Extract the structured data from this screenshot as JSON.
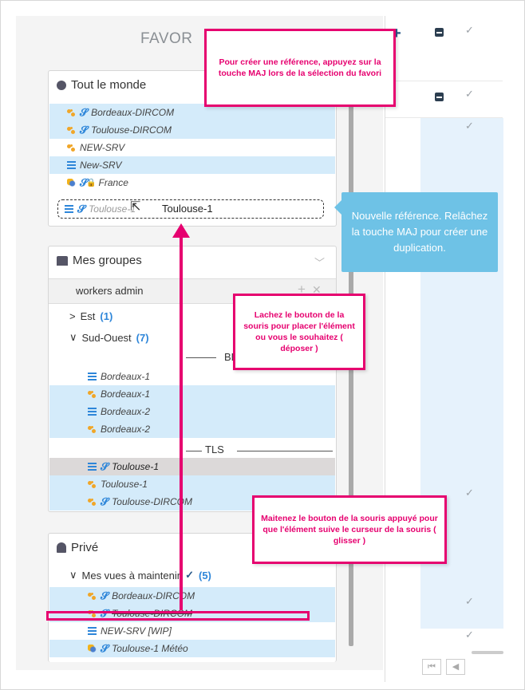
{
  "title": "FAVOR",
  "plus_icon": "+",
  "top_callout": "Pour créer une référence, appuyez sur la touche MAJ lors de la sélection du favori",
  "tooltip": "Nouvelle référence. Relâchez la touche MAJ pour créer une duplication.",
  "drop_callout": "Lachez le bouton de la souris pour placer l'élément ou vous le souhaitez ( déposer )",
  "drag_callout": "Maitenez le bouton de la souris appuyé pour que l'élément suive le curseur de la souris ( glisser )",
  "everyone": {
    "header": "Tout le monde",
    "items": [
      {
        "label": "Bordeaux-DIRCOM",
        "icon": "workflow-icon",
        "link": true,
        "selected": true
      },
      {
        "label": "Toulouse-DIRCOM",
        "icon": "workflow-icon",
        "link": true,
        "selected": true
      },
      {
        "label": "NEW-SRV",
        "icon": "workflow-icon",
        "link": false,
        "selected": false
      },
      {
        "label": "New-SRV",
        "icon": "list-icon",
        "link": false,
        "selected": true
      },
      {
        "label": "France",
        "icon": "weather-icon",
        "link": true,
        "selected": false
      }
    ],
    "drag_row_label": "Toulouse-1",
    "drag_ghost_label": "Toulouse-1"
  },
  "groups": {
    "header": "Mes groupes",
    "subheader": "workers admin",
    "est_label": "Est",
    "est_count": "(1)",
    "so_label": "Sud-Ouest",
    "so_count": "(7)",
    "bdx_label": "BDX",
    "tls_label": "TLS",
    "bdx_items": [
      "Bordeaux-1",
      "Bordeaux-1",
      "Bordeaux-2",
      "Bordeaux-2"
    ],
    "tls_items": [
      "Toulouse-1",
      "Toulouse-1",
      "Toulouse-DIRCOM"
    ]
  },
  "prive": {
    "header": "Privé",
    "subheader": "Mes vues à maintenir",
    "count": "(5)",
    "items": [
      "Bordeaux-DIRCOM",
      "Toulouse-DIRCOM",
      "NEW-SRV [WIP]",
      "Toulouse-1 Météo"
    ]
  },
  "colors": {
    "accent": "#e6006f",
    "tooltip": "#6ec2e6",
    "selection": "#d4ebfa"
  }
}
